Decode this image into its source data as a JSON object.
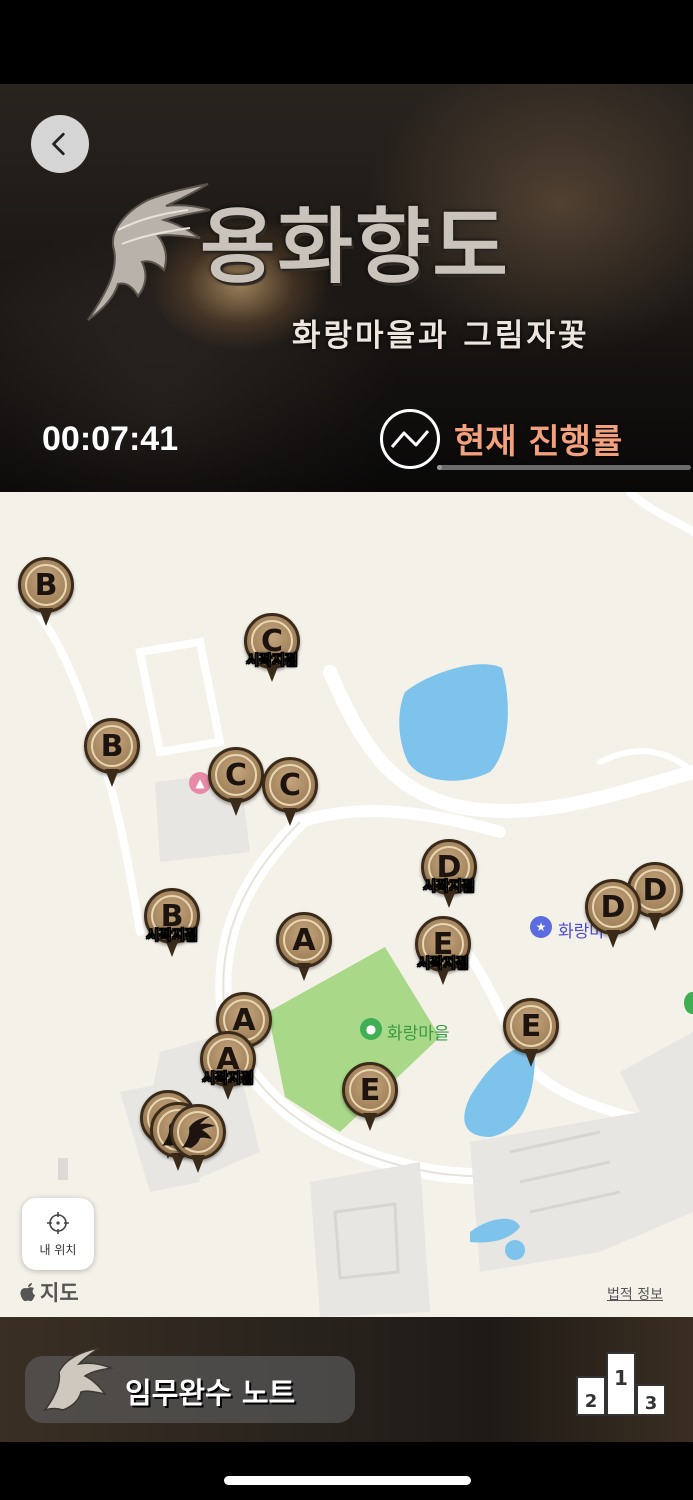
{
  "header": {
    "back_icon": "chevron-left-icon",
    "title": "용화향도",
    "subtitle": "화랑마을과 그림자꽃",
    "timer": "00:07:41",
    "progress_icon": "trend-line-icon",
    "progress_label": "현재 진행률",
    "progress_fraction": 0.02
  },
  "map": {
    "start_label": "시작지점",
    "places": {
      "village": "화랑마을",
      "hwarang": "화랑마"
    },
    "pins": [
      {
        "letter": "B",
        "start": false
      },
      {
        "letter": "C",
        "start": true
      },
      {
        "letter": "B",
        "start": false
      },
      {
        "letter": "C",
        "start": false
      },
      {
        "letter": "C",
        "start": false
      },
      {
        "letter": "D",
        "start": true
      },
      {
        "letter": "D",
        "start": false
      },
      {
        "letter": "D",
        "start": false
      },
      {
        "letter": "B",
        "start": true
      },
      {
        "letter": "A",
        "start": false
      },
      {
        "letter": "E",
        "start": true
      },
      {
        "letter": "A",
        "start": false
      },
      {
        "letter": "A",
        "start": true
      },
      {
        "letter": "E",
        "start": false
      },
      {
        "letter": "E",
        "start": false
      },
      {
        "letter": "",
        "start": false,
        "icon": "dragon-icon"
      },
      {
        "letter": "",
        "start": false,
        "icon": "dragon-icon"
      },
      {
        "letter": "",
        "start": false,
        "icon": "dragon-icon"
      }
    ],
    "my_location_label": "내 위치",
    "my_location_icon": "crosshair-icon",
    "brand": "지도",
    "brand_icon": "apple-icon",
    "legal": "법적 정보"
  },
  "bottom": {
    "note_label": "임무완수 노트",
    "note_icon": "dragon-icon",
    "rank_icon": "podium-icon",
    "podium": [
      "2",
      "1",
      "3"
    ]
  },
  "colors": {
    "accent": "#f3a07c",
    "pin_bronze": "#9c7d56",
    "map_bg": "#f4f1e9",
    "water": "#7ec3ec",
    "park": "#a8d888"
  }
}
